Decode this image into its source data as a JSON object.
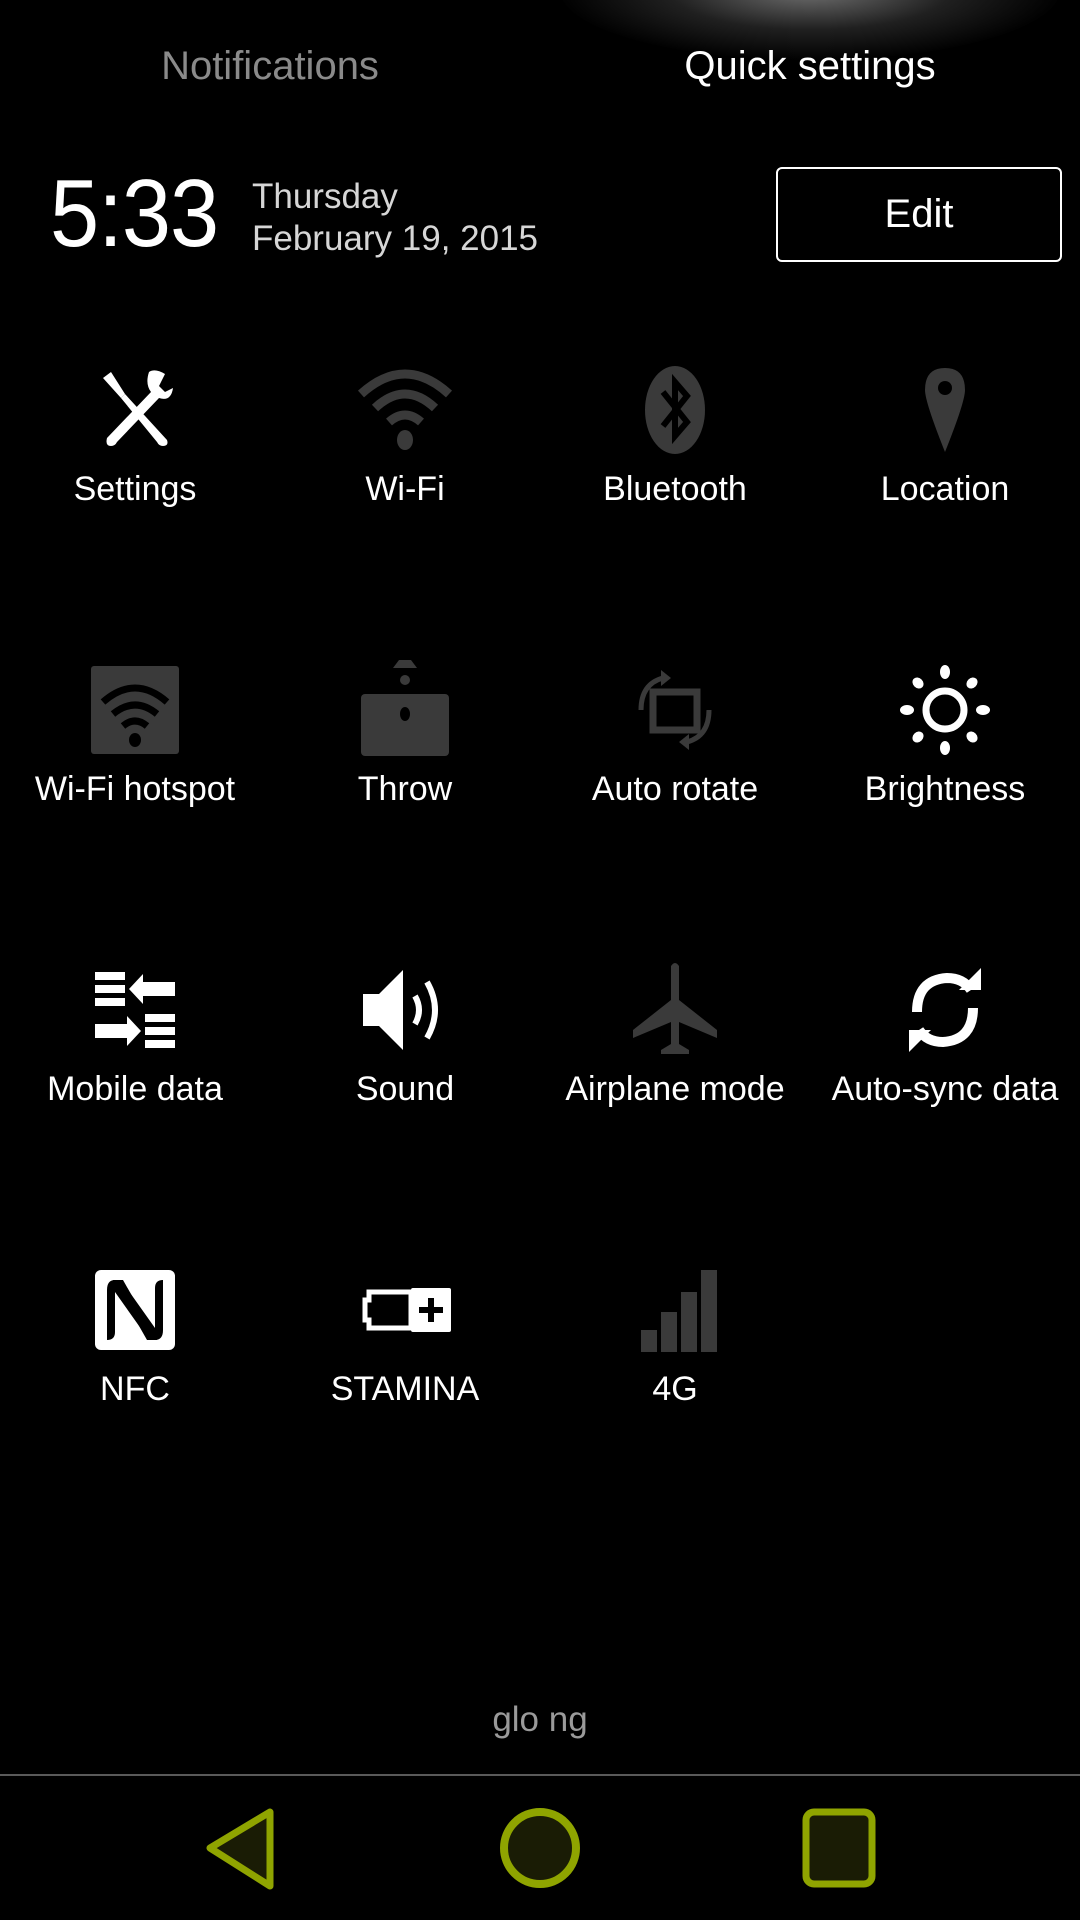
{
  "tabs": [
    {
      "label": "Notifications",
      "active": false
    },
    {
      "label": "Quick settings",
      "active": true
    }
  ],
  "header": {
    "time": "5:33",
    "day": "Thursday",
    "date": "February 19, 2015",
    "edit_label": "Edit"
  },
  "tiles": [
    {
      "label": "Settings",
      "icon": "settings-icon",
      "state": "on"
    },
    {
      "label": "Wi-Fi",
      "icon": "wifi-icon",
      "state": "off"
    },
    {
      "label": "Bluetooth",
      "icon": "bluetooth-icon",
      "state": "off"
    },
    {
      "label": "Location",
      "icon": "location-icon",
      "state": "off"
    },
    {
      "label": "Wi-Fi hotspot",
      "icon": "wifi-hotspot-icon",
      "state": "off"
    },
    {
      "label": "Throw",
      "icon": "throw-icon",
      "state": "off"
    },
    {
      "label": "Auto rotate",
      "icon": "auto-rotate-icon",
      "state": "off"
    },
    {
      "label": "Brightness",
      "icon": "brightness-icon",
      "state": "on"
    },
    {
      "label": "Mobile data",
      "icon": "mobile-data-icon",
      "state": "on"
    },
    {
      "label": "Sound",
      "icon": "sound-icon",
      "state": "on"
    },
    {
      "label": "Airplane mode",
      "icon": "airplane-icon",
      "state": "off"
    },
    {
      "label": "Auto-sync data",
      "icon": "sync-icon",
      "state": "on"
    },
    {
      "label": "NFC",
      "icon": "nfc-icon",
      "state": "on"
    },
    {
      "label": "STAMINA",
      "icon": "battery-stamina-icon",
      "state": "on"
    },
    {
      "label": "4G",
      "icon": "signal-4g-icon",
      "state": "off"
    }
  ],
  "footer": {
    "carrier": "glo ng"
  },
  "colors": {
    "on": "#ffffff",
    "off": "#3a3a3a",
    "nav_accent": "#8fa400",
    "nav_fill": "#1a1c05"
  },
  "nav": [
    {
      "name": "back",
      "icon": "back-icon"
    },
    {
      "name": "home",
      "icon": "home-icon"
    },
    {
      "name": "recents",
      "icon": "recents-icon"
    }
  ]
}
